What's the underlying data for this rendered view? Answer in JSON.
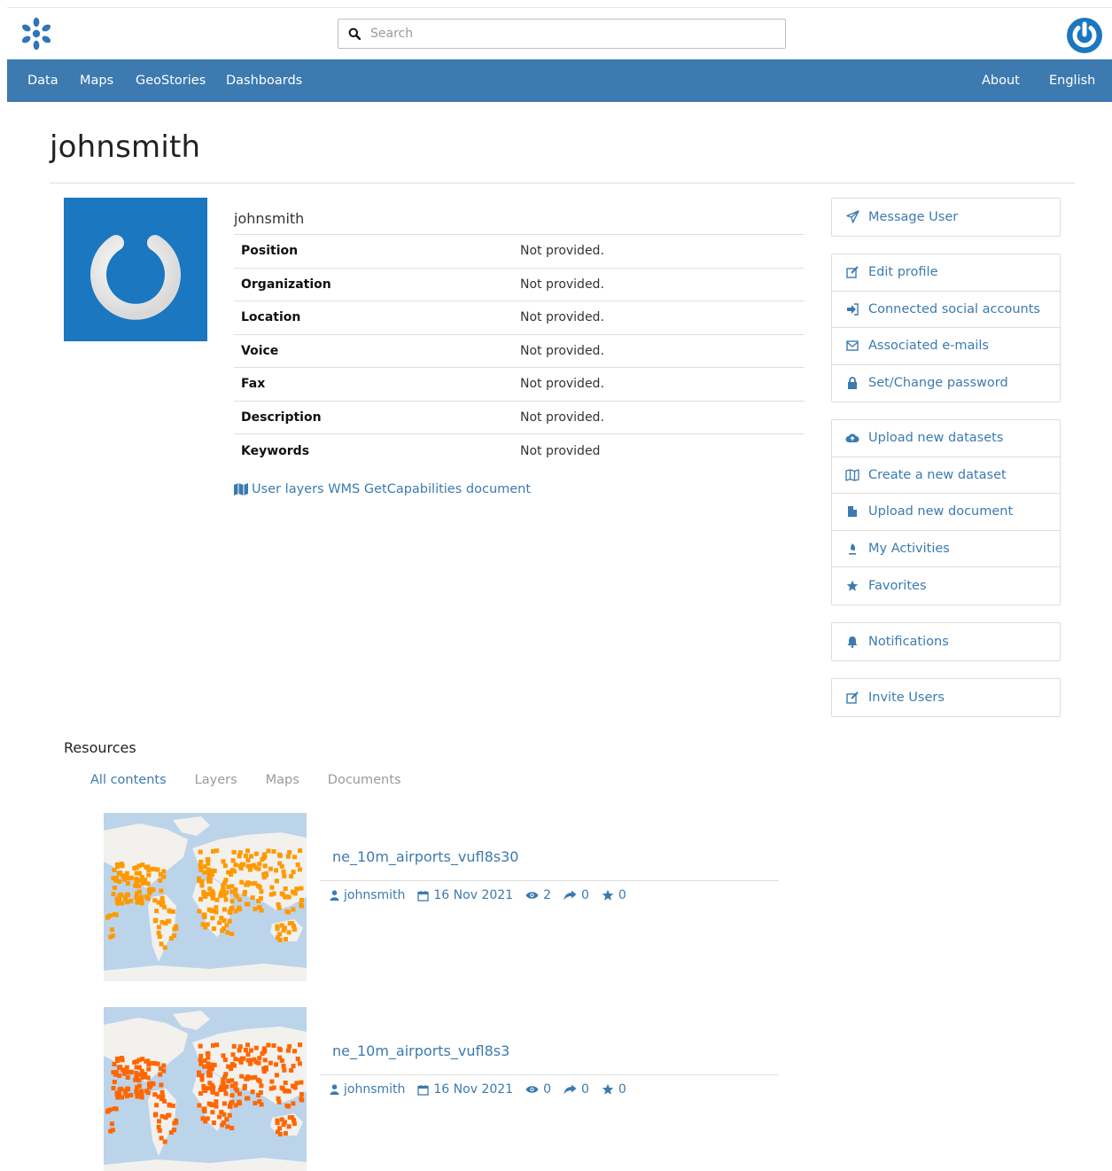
{
  "header": {
    "search_placeholder": "Search"
  },
  "nav": {
    "left": [
      "Data",
      "Maps",
      "GeoStories",
      "Dashboards"
    ],
    "right": [
      "About",
      "English"
    ]
  },
  "profile": {
    "page_title": "johnsmith",
    "username": "johnsmith",
    "fields": [
      {
        "label": "Position",
        "value": "Not provided."
      },
      {
        "label": "Organization",
        "value": "Not provided."
      },
      {
        "label": "Location",
        "value": "Not provided."
      },
      {
        "label": "Voice",
        "value": "Not provided."
      },
      {
        "label": "Fax",
        "value": "Not provided."
      },
      {
        "label": "Description",
        "value": "Not provided."
      },
      {
        "label": "Keywords",
        "value": "Not provided"
      }
    ],
    "wms_link": "User layers WMS GetCapabilities document"
  },
  "sidebar": {
    "groups": [
      [
        {
          "label": "Message User",
          "icon": "paper-plane-icon"
        }
      ],
      [
        {
          "label": "Edit profile",
          "icon": "edit-icon"
        },
        {
          "label": "Connected social accounts",
          "icon": "sign-in-icon"
        },
        {
          "label": "Associated e-mails",
          "icon": "envelope-icon"
        },
        {
          "label": "Set/Change password",
          "icon": "lock-icon"
        }
      ],
      [
        {
          "label": "Upload new datasets",
          "icon": "cloud-upload-icon"
        },
        {
          "label": "Create a new dataset",
          "icon": "map-icon"
        },
        {
          "label": "Upload new document",
          "icon": "file-icon"
        },
        {
          "label": "My Activities",
          "icon": "fire-icon"
        },
        {
          "label": "Favorites",
          "icon": "star-icon"
        }
      ],
      [
        {
          "label": "Notifications",
          "icon": "bell-icon"
        }
      ],
      [
        {
          "label": "Invite Users",
          "icon": "edit-icon"
        }
      ]
    ]
  },
  "resources": {
    "title": "Resources",
    "tabs": [
      "All contents",
      "Layers",
      "Maps",
      "Documents"
    ],
    "active_tab": "All contents",
    "items": [
      {
        "title": "ne_10m_airports_vufl8s30",
        "owner": "johnsmith",
        "date": "16 Nov 2021",
        "views": "2",
        "shares": "0",
        "rating": "0",
        "marker_color": "#ff9900"
      },
      {
        "title": "ne_10m_airports_vufl8s3",
        "owner": "johnsmith",
        "date": "16 Nov 2021",
        "views": "0",
        "shares": "0",
        "rating": "0",
        "marker_color": "#ff6600"
      }
    ]
  },
  "colors": {
    "navbar": "#3c7ab0",
    "link": "#3c7ab0",
    "avatar_bg": "#1a77c0"
  }
}
